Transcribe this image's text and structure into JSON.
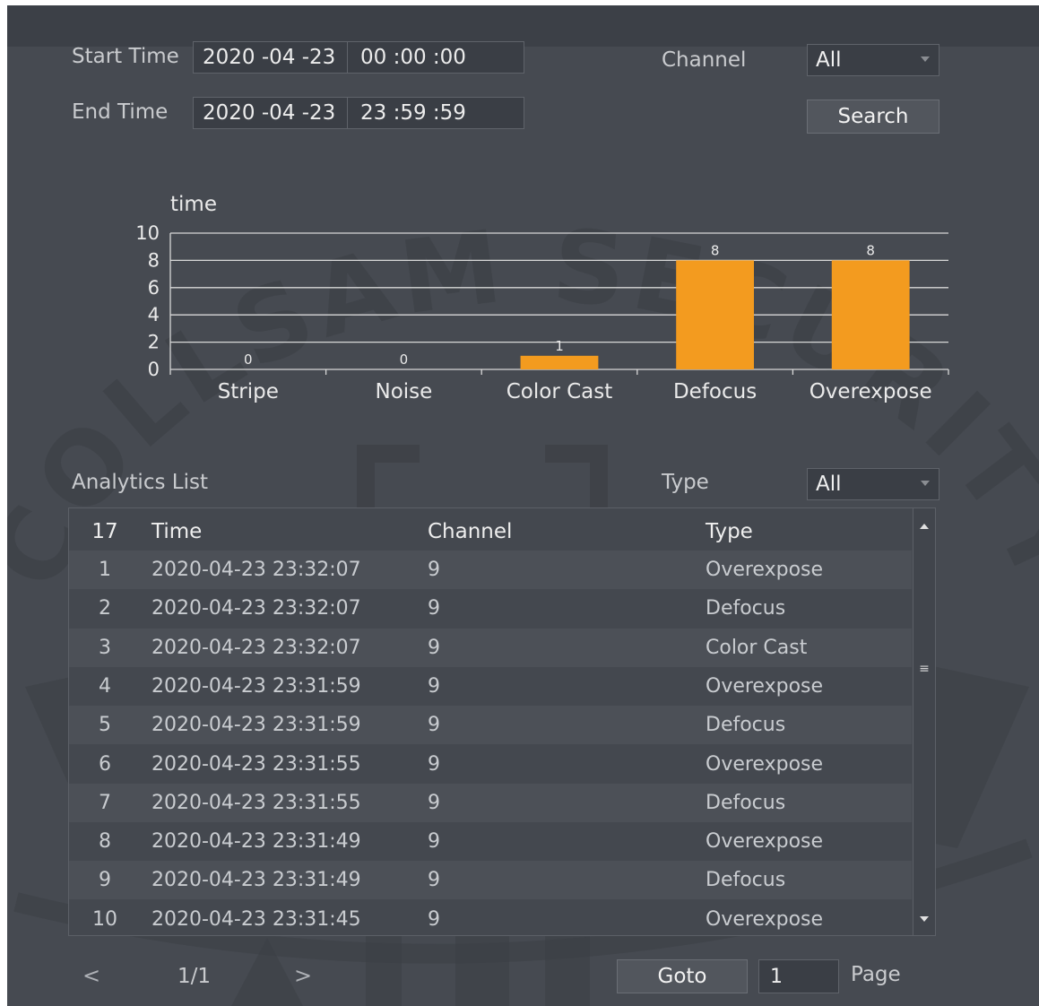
{
  "filters": {
    "start_label": "Start Time",
    "start_date": "2020 -04 -23",
    "start_time": "00 :00 :00",
    "end_label": "End Time",
    "end_date": "2020 -04 -23",
    "end_time": "23 :59 :59",
    "channel_label": "Channel",
    "channel_value": "All",
    "search_label": "Search"
  },
  "chart_data": {
    "type": "bar",
    "ylabel": "time",
    "categories": [
      "Stripe",
      "Noise",
      "Color Cast",
      "Defocus",
      "Overexpose"
    ],
    "values": [
      0,
      0,
      1,
      8,
      8
    ],
    "ylim": [
      0,
      10
    ],
    "yticks": [
      0,
      2,
      4,
      6,
      8,
      10
    ],
    "grid": true,
    "bar_color": "#f39b1f"
  },
  "list": {
    "title": "Analytics List",
    "type_label": "Type",
    "type_value": "All",
    "count": "17",
    "columns": [
      "Time",
      "Channel",
      "Type"
    ],
    "rows": [
      {
        "idx": "1",
        "time": "2020-04-23 23:32:07",
        "channel": "9",
        "type": "Overexpose"
      },
      {
        "idx": "2",
        "time": "2020-04-23 23:32:07",
        "channel": "9",
        "type": "Defocus"
      },
      {
        "idx": "3",
        "time": "2020-04-23 23:32:07",
        "channel": "9",
        "type": "Color Cast"
      },
      {
        "idx": "4",
        "time": "2020-04-23 23:31:59",
        "channel": "9",
        "type": "Overexpose"
      },
      {
        "idx": "5",
        "time": "2020-04-23 23:31:59",
        "channel": "9",
        "type": "Defocus"
      },
      {
        "idx": "6",
        "time": "2020-04-23 23:31:55",
        "channel": "9",
        "type": "Overexpose"
      },
      {
        "idx": "7",
        "time": "2020-04-23 23:31:55",
        "channel": "9",
        "type": "Defocus"
      },
      {
        "idx": "8",
        "time": "2020-04-23 23:31:49",
        "channel": "9",
        "type": "Overexpose"
      },
      {
        "idx": "9",
        "time": "2020-04-23 23:31:49",
        "channel": "9",
        "type": "Defocus"
      },
      {
        "idx": "10",
        "time": "2020-04-23 23:31:45",
        "channel": "9",
        "type": "Overexpose"
      }
    ]
  },
  "pager": {
    "prev": "<",
    "page_info": "1/1",
    "next": ">",
    "goto_label": "Goto",
    "goto_value": "1",
    "page_label": "Page"
  },
  "watermark": "COLLSAM SECURITY"
}
